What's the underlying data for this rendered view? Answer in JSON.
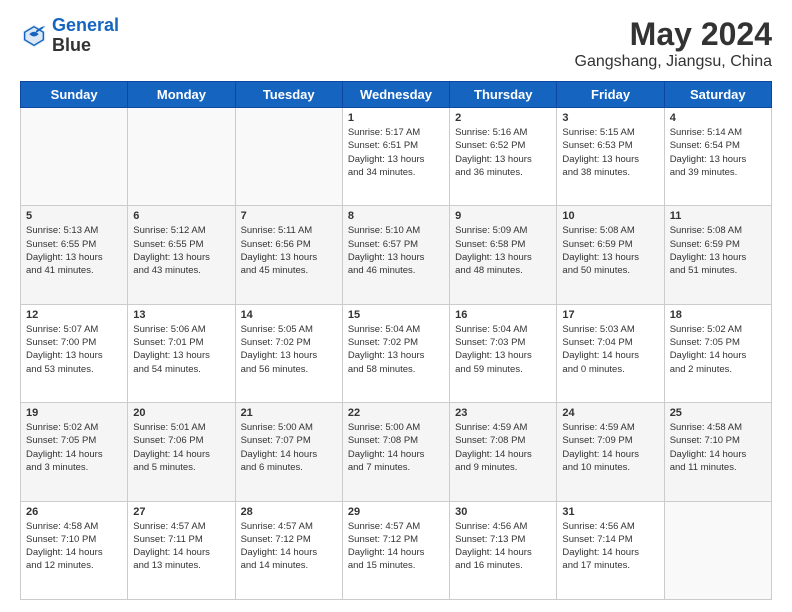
{
  "header": {
    "logo_line1": "General",
    "logo_line2": "Blue",
    "title": "May 2024",
    "subtitle": "Gangshang, Jiangsu, China"
  },
  "days_of_week": [
    "Sunday",
    "Monday",
    "Tuesday",
    "Wednesday",
    "Thursday",
    "Friday",
    "Saturday"
  ],
  "weeks": [
    [
      {
        "day": "",
        "info": ""
      },
      {
        "day": "",
        "info": ""
      },
      {
        "day": "",
        "info": ""
      },
      {
        "day": "1",
        "info": "Sunrise: 5:17 AM\nSunset: 6:51 PM\nDaylight: 13 hours\nand 34 minutes."
      },
      {
        "day": "2",
        "info": "Sunrise: 5:16 AM\nSunset: 6:52 PM\nDaylight: 13 hours\nand 36 minutes."
      },
      {
        "day": "3",
        "info": "Sunrise: 5:15 AM\nSunset: 6:53 PM\nDaylight: 13 hours\nand 38 minutes."
      },
      {
        "day": "4",
        "info": "Sunrise: 5:14 AM\nSunset: 6:54 PM\nDaylight: 13 hours\nand 39 minutes."
      }
    ],
    [
      {
        "day": "5",
        "info": "Sunrise: 5:13 AM\nSunset: 6:55 PM\nDaylight: 13 hours\nand 41 minutes."
      },
      {
        "day": "6",
        "info": "Sunrise: 5:12 AM\nSunset: 6:55 PM\nDaylight: 13 hours\nand 43 minutes."
      },
      {
        "day": "7",
        "info": "Sunrise: 5:11 AM\nSunset: 6:56 PM\nDaylight: 13 hours\nand 45 minutes."
      },
      {
        "day": "8",
        "info": "Sunrise: 5:10 AM\nSunset: 6:57 PM\nDaylight: 13 hours\nand 46 minutes."
      },
      {
        "day": "9",
        "info": "Sunrise: 5:09 AM\nSunset: 6:58 PM\nDaylight: 13 hours\nand 48 minutes."
      },
      {
        "day": "10",
        "info": "Sunrise: 5:08 AM\nSunset: 6:59 PM\nDaylight: 13 hours\nand 50 minutes."
      },
      {
        "day": "11",
        "info": "Sunrise: 5:08 AM\nSunset: 6:59 PM\nDaylight: 13 hours\nand 51 minutes."
      }
    ],
    [
      {
        "day": "12",
        "info": "Sunrise: 5:07 AM\nSunset: 7:00 PM\nDaylight: 13 hours\nand 53 minutes."
      },
      {
        "day": "13",
        "info": "Sunrise: 5:06 AM\nSunset: 7:01 PM\nDaylight: 13 hours\nand 54 minutes."
      },
      {
        "day": "14",
        "info": "Sunrise: 5:05 AM\nSunset: 7:02 PM\nDaylight: 13 hours\nand 56 minutes."
      },
      {
        "day": "15",
        "info": "Sunrise: 5:04 AM\nSunset: 7:02 PM\nDaylight: 13 hours\nand 58 minutes."
      },
      {
        "day": "16",
        "info": "Sunrise: 5:04 AM\nSunset: 7:03 PM\nDaylight: 13 hours\nand 59 minutes."
      },
      {
        "day": "17",
        "info": "Sunrise: 5:03 AM\nSunset: 7:04 PM\nDaylight: 14 hours\nand 0 minutes."
      },
      {
        "day": "18",
        "info": "Sunrise: 5:02 AM\nSunset: 7:05 PM\nDaylight: 14 hours\nand 2 minutes."
      }
    ],
    [
      {
        "day": "19",
        "info": "Sunrise: 5:02 AM\nSunset: 7:05 PM\nDaylight: 14 hours\nand 3 minutes."
      },
      {
        "day": "20",
        "info": "Sunrise: 5:01 AM\nSunset: 7:06 PM\nDaylight: 14 hours\nand 5 minutes."
      },
      {
        "day": "21",
        "info": "Sunrise: 5:00 AM\nSunset: 7:07 PM\nDaylight: 14 hours\nand 6 minutes."
      },
      {
        "day": "22",
        "info": "Sunrise: 5:00 AM\nSunset: 7:08 PM\nDaylight: 14 hours\nand 7 minutes."
      },
      {
        "day": "23",
        "info": "Sunrise: 4:59 AM\nSunset: 7:08 PM\nDaylight: 14 hours\nand 9 minutes."
      },
      {
        "day": "24",
        "info": "Sunrise: 4:59 AM\nSunset: 7:09 PM\nDaylight: 14 hours\nand 10 minutes."
      },
      {
        "day": "25",
        "info": "Sunrise: 4:58 AM\nSunset: 7:10 PM\nDaylight: 14 hours\nand 11 minutes."
      }
    ],
    [
      {
        "day": "26",
        "info": "Sunrise: 4:58 AM\nSunset: 7:10 PM\nDaylight: 14 hours\nand 12 minutes."
      },
      {
        "day": "27",
        "info": "Sunrise: 4:57 AM\nSunset: 7:11 PM\nDaylight: 14 hours\nand 13 minutes."
      },
      {
        "day": "28",
        "info": "Sunrise: 4:57 AM\nSunset: 7:12 PM\nDaylight: 14 hours\nand 14 minutes."
      },
      {
        "day": "29",
        "info": "Sunrise: 4:57 AM\nSunset: 7:12 PM\nDaylight: 14 hours\nand 15 minutes."
      },
      {
        "day": "30",
        "info": "Sunrise: 4:56 AM\nSunset: 7:13 PM\nDaylight: 14 hours\nand 16 minutes."
      },
      {
        "day": "31",
        "info": "Sunrise: 4:56 AM\nSunset: 7:14 PM\nDaylight: 14 hours\nand 17 minutes."
      },
      {
        "day": "",
        "info": ""
      }
    ]
  ]
}
